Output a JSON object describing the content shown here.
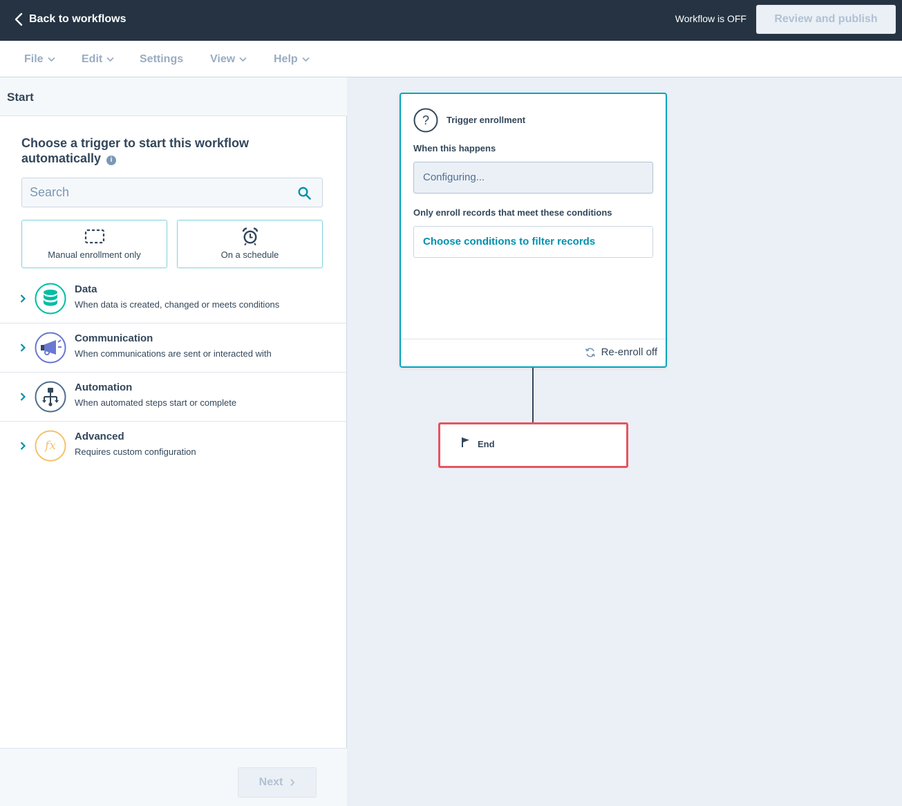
{
  "header": {
    "back_label": "Back to workflows",
    "workflow_status": "Workflow is OFF",
    "publish_label": "Review and publish"
  },
  "menu": {
    "items": [
      {
        "label": "File",
        "has_dropdown": true
      },
      {
        "label": "Edit",
        "has_dropdown": true
      },
      {
        "label": "Settings",
        "has_dropdown": false
      },
      {
        "label": "View",
        "has_dropdown": true
      },
      {
        "label": "Help",
        "has_dropdown": true
      }
    ]
  },
  "panel": {
    "title": "Start",
    "heading": "Choose a trigger to start this workflow automatically",
    "search_placeholder": "Search",
    "tiles": [
      {
        "label": "Manual enrollment only",
        "icon": "dashed-box-icon"
      },
      {
        "label": "On a schedule",
        "icon": "alarm-clock-icon"
      }
    ],
    "categories": [
      {
        "title": "Data",
        "description": "When data is created, changed or meets conditions",
        "icon": "database-icon"
      },
      {
        "title": "Communication",
        "description": "When communications are sent or interacted with",
        "icon": "megaphone-icon"
      },
      {
        "title": "Automation",
        "description": "When automated steps start or complete",
        "icon": "flow-icon"
      },
      {
        "title": "Advanced",
        "description": "Requires custom configuration",
        "icon": "function-icon",
        "icon_text": "fx"
      }
    ],
    "next_label": "Next"
  },
  "canvas": {
    "trigger": {
      "title": "Trigger enrollment",
      "when_label": "When this happens",
      "when_value": "Configuring...",
      "conditions_label": "Only enroll records that meet these conditions",
      "filter_button": "Choose conditions to filter records",
      "reenroll_label": "Re-enroll off"
    },
    "end_label": "End"
  },
  "colors": {
    "topbar": "#253342",
    "accent_teal": "#00a4bd",
    "link_teal": "#0091ae",
    "end_border": "#e6555f",
    "text": "#33475b"
  }
}
